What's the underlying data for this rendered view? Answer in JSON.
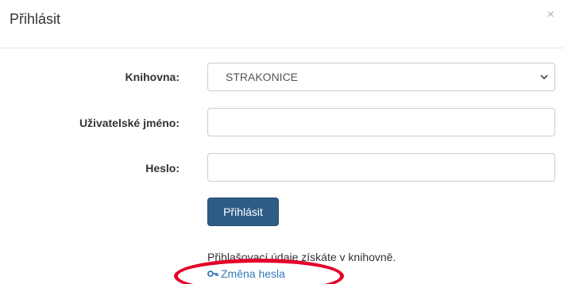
{
  "modal": {
    "title": "Přihlásit",
    "close_label": "×"
  },
  "form": {
    "library_label": "Knihovna:",
    "library_value": "STRAKONICE",
    "username_label": "Uživatelské jméno:",
    "username_value": "",
    "password_label": "Heslo:",
    "password_value": "",
    "submit_label": "Přihlásit",
    "hint_text": "Přihlašovací údaje získáte v knihovně.",
    "change_password_label": "Změna hesla"
  },
  "icons": {
    "close": "close-icon",
    "select_arrow": "chevron-down-icon",
    "change_password": "key-icon"
  },
  "colors": {
    "primary_button": "#2e5c86",
    "link": "#337ab7",
    "annotation": "#e4002b"
  }
}
